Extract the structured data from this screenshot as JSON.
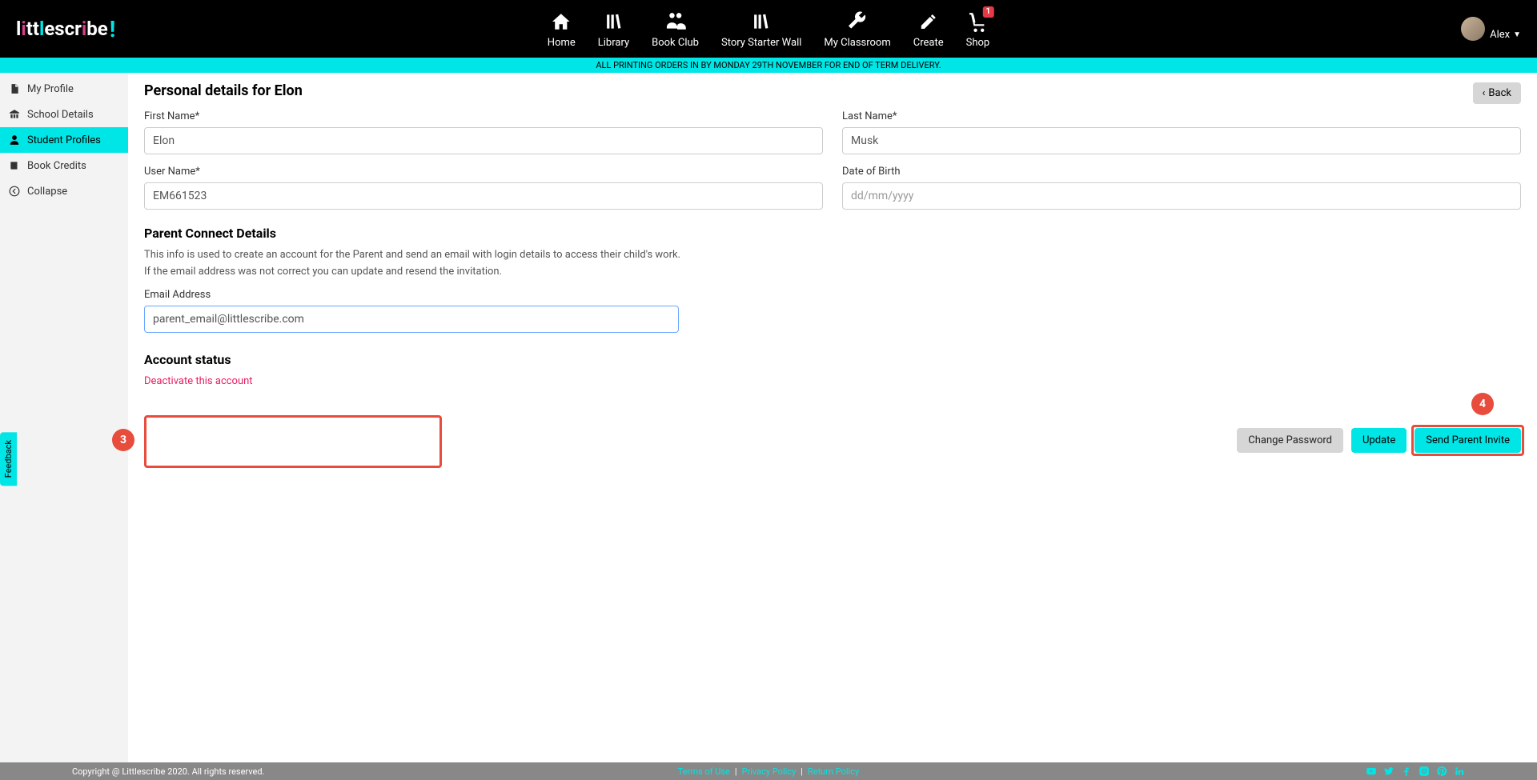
{
  "header": {
    "nav": [
      {
        "label": "Home"
      },
      {
        "label": "Library"
      },
      {
        "label": "Book Club"
      },
      {
        "label": "Story Starter Wall"
      },
      {
        "label": "My Classroom"
      },
      {
        "label": "Create"
      },
      {
        "label": "Shop"
      }
    ],
    "cart_badge": "1",
    "user_name": "Alex"
  },
  "banner": "ALL PRINTING ORDERS IN BY MONDAY 29TH NOVEMBER FOR END OF TERM DELIVERY.",
  "sidebar": {
    "items": [
      {
        "label": "My Profile"
      },
      {
        "label": "School Details"
      },
      {
        "label": "Student Profiles"
      },
      {
        "label": "Book Credits"
      },
      {
        "label": "Collapse"
      }
    ]
  },
  "page": {
    "title": "Personal details for Elon",
    "back_label": "Back",
    "first_name_label": "First Name*",
    "first_name_value": "Elon",
    "last_name_label": "Last Name*",
    "last_name_value": "Musk",
    "user_name_label": "User Name*",
    "user_name_value": "EM661523",
    "dob_label": "Date of Birth",
    "dob_placeholder": "dd/mm/yyyy",
    "parent_section_title": "Parent Connect Details",
    "parent_help1": "This info is used to create an account for the Parent and send an email with login details to access their child's work.",
    "parent_help2": "If the email address was not correct you can update and resend the invitation.",
    "email_label": "Email Address",
    "email_value": "parent_email@littlescribe.com",
    "account_status_title": "Account status",
    "deactivate_label": "Deactivate this account",
    "actions": {
      "change_password": "Change Password",
      "update": "Update",
      "send_invite": "Send Parent Invite"
    }
  },
  "callouts": {
    "three": "3",
    "four": "4"
  },
  "feedback": "Feedback",
  "footer": {
    "copyright": "Copyright @ Littlescribe 2020. All rights reserved.",
    "links": [
      "Terms of Use",
      "Privacy Policy",
      "Return Policy"
    ],
    "sep": "|"
  }
}
